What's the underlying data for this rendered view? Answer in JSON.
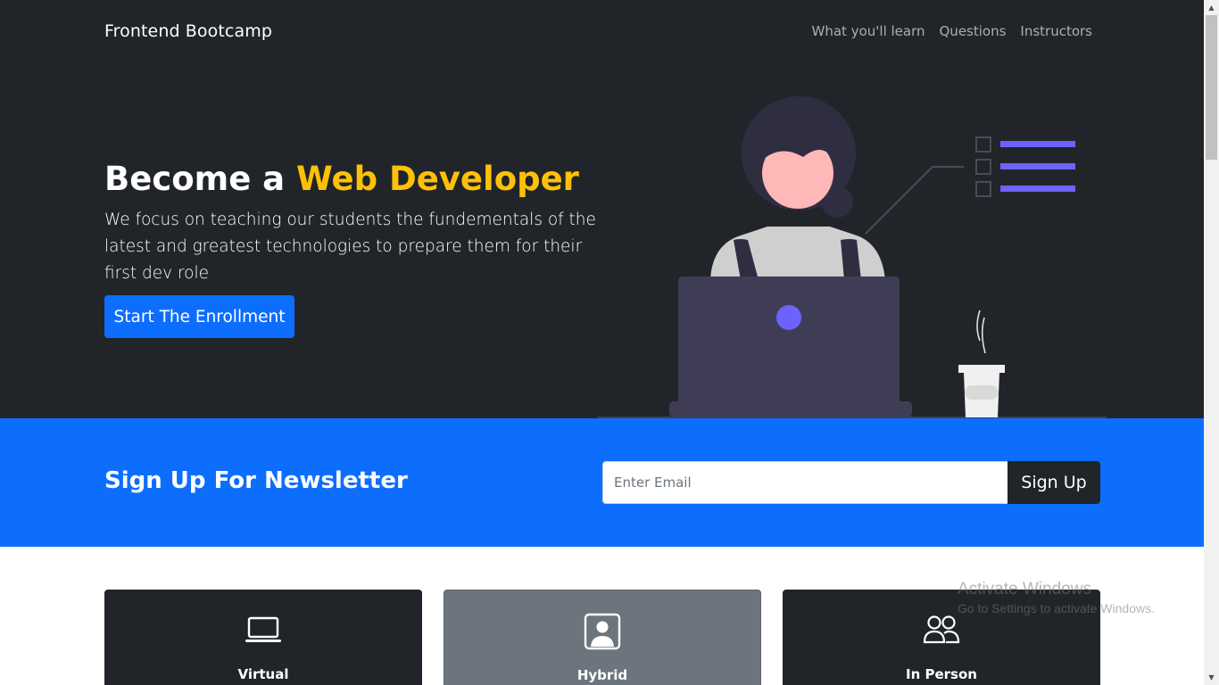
{
  "navbar": {
    "brand": "Frontend Bootcamp",
    "links": [
      "What you'll learn",
      "Questions",
      "Instructors"
    ]
  },
  "hero": {
    "title_prefix": "Become a ",
    "title_accent": "Web Developer",
    "lead": "We focus on teaching our students the fundementals of the latest and greatest technologies to prepare them for their first dev role",
    "cta_label": "Start The Enrollment"
  },
  "newsletter": {
    "title": "Sign Up For Newsletter",
    "email_placeholder": "Enter Email",
    "email_value": "",
    "button_label": "Sign Up"
  },
  "boxes": [
    {
      "title": "Virtual",
      "icon": "laptop-icon"
    },
    {
      "title": "Hybrid",
      "icon": "person-square-icon"
    },
    {
      "title": "In Person",
      "icon": "people-icon"
    }
  ],
  "watermark": {
    "title": "Activate Windows",
    "subtitle": "Go to Settings to activate Windows."
  },
  "scrollbar": {
    "up_arrow": "▲",
    "down_arrow": "▼"
  },
  "colors": {
    "dark": "#212529",
    "primary": "#0d6efd",
    "accent": "#ffc107",
    "secondary": "#6c757d",
    "illustration_purple": "#6c63ff"
  }
}
